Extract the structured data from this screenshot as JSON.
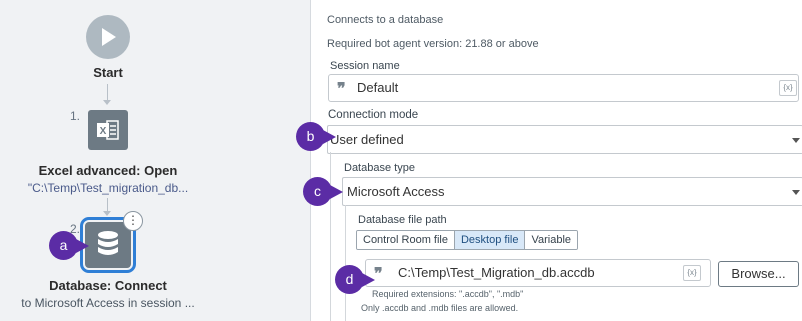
{
  "flow": {
    "start_label": "Start",
    "step1": {
      "number": "1.",
      "title": "Excel advanced: Open",
      "subtitle": "\"C:\\Temp\\Test_migration_db..."
    },
    "step2": {
      "number": "2.",
      "title": "Database: Connect",
      "subtitle": "to Microsoft Access in session ..."
    },
    "more_icon": "kebab-icon",
    "icons": [
      "play-icon",
      "excel-icon",
      "database-icon"
    ]
  },
  "callouts": {
    "a": "a",
    "b": "b",
    "c": "c",
    "d": "d"
  },
  "props": {
    "description": "Connects to a database",
    "version_note": "Required bot agent version: 21.88 or above",
    "session_name": {
      "label": "Session name",
      "value": "Default",
      "fx": "{x}"
    },
    "connection_mode": {
      "label": "Connection mode",
      "value": "User defined"
    },
    "database_type": {
      "label": "Database type",
      "value": "Microsoft Access"
    },
    "database_file": {
      "label": "Database file path",
      "options": [
        "Control Room file",
        "Desktop file",
        "Variable"
      ],
      "selected": "Desktop file",
      "value": "C:\\Temp\\Test_Migration_db.accdb",
      "fx": "{x}",
      "browse_label": "Browse...",
      "required_extensions": "Required extensions: \".accdb\", \".mdb\"",
      "allowed_note": "Only .accdb and .mdb files are allowed."
    }
  },
  "colors": {
    "accent_blue": "#2f7fd6",
    "callout_purple": "#5b2ca5",
    "icon_box": "#6d7a84"
  }
}
